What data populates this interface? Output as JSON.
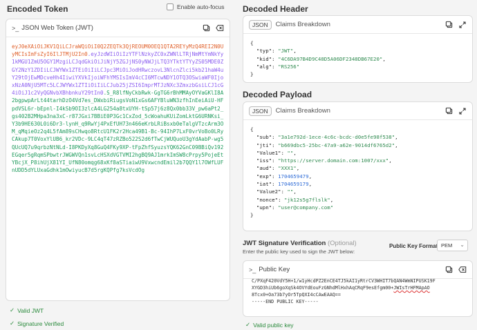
{
  "left": {
    "encoded_title": "Encoded Token",
    "autofocus_label": "Enable auto-focus",
    "card_title": "JSON Web Token (JWT)",
    "jwt_header": "eyJ0eXAiOiJKV1QiLCJraWQiOiI0Q2ZEQTk3QjREOUM0OEQ1QTA2REYyMzQ4REI2N0UyMCIsImFsZyI6IlJTMjU2In0",
    "jwt_payload": ".eyJzdWIiOiIzYTFlNzkyZC0xZWNlLTRjNmMtYmNkYy1kMGU1ZmU5OGY1MzgiLCJqdGkiOiJiNjY5ZGJjNS0yNWJjLTQ3YTktYTYyZS05MDE0ZGY2NzY1ZDIiLCJWYWx1ZTEiOiIiLCJpc3MiOiJodHRwczovL3NlcnZlci5kb21haW4uY29tOjEwMDcveHh4IiwiYXVkIjoiWFhYMSIsImV4cCI6MTcwNDY1OTQ3OSwiaWF0IjoxNzA0NjU5MTc5LCJWYWx1ZTIiOiIiLCJub25jZSI6ImprMTJzNXc3ZmxzbGsiLCJ1cG4iOiJ1c2VyQGNvbXBhbnkuY29tIn0",
    "jwt_signature": ".S_R8lfNyCkbRwk-GgTG6rBhMMAyOYVaGKlI8A2bgpwpArLt44tarhDzO4Vd7es_DWxbiRiugsVoN1xGs6AFYBluWN3zfhInEeiAiU-HFpdVSL6r-bEpnl-I4kSb9OI3zlcA4LG254a8txUYH-tSp57j6z8Qx0bb33V_pw6aPt2_gs402B2MHpa3na3xC-r87JGxi7BBiE0P3Gc1CxZod_5cWoahuKUiZomLktG6URNKsi_Y3b9HE630L0i6Dr3-lynH_q9RwYj4PxEfUH73n466eKrbLRiBsxb0eTalgVTzcArm3OM_qMqieOz2q4L5fAm89sCHwqo8RtcU1FK2r2Hca49B1-Bc-94IhP7LxF0vrVoBo0LRyCAkup7T0VoxYlUB6_kr2VDc-9LC4qT47zRZBo522S2d6fTwCjWUQuoU3gYdAabP-wg5QUcUQ7u9qrbzNtNLd-I8PKDyXq8GuQ4FKy9XP-tFpZhfSyuzsYQK62GnC09BBiQv192EGqer5gRqmSPbwtrJWGWVQn1svLcHSXdVGTVMI2hgBQ9AJ1mrkImSW8cPrpy5PojeEtYBcjX_P8ihUjX81YI_UfN80omqg68xKf8aSTiaiwU9VxwcndEmil2b7QQY1l7OWfLUFnUDD5dYLUxaGdhk1mOwiyucB7d5rgKQPfg7ksVcdOg",
    "valid_jwt": "Valid JWT",
    "signature_verified": "Signature Verified"
  },
  "right": {
    "header_title": "Decoded Header",
    "payload_title": "Decoded Payload",
    "tab_json": "JSON",
    "tab_claims": "Claims Breakdown",
    "header_json": {
      "typ": "\"JWT\"",
      "kid": "\"4C6DA97B4D9C48D5A06DF2348DB67E20\"",
      "alg": "\"RS256\""
    },
    "payload_json": {
      "sub": "\"3a1e792d-1ece-4c6c-bcdc-d0e5fe98f538\"",
      "jti": "\"b669dbc5-25bc-47a9-a62e-9014df6765d2\"",
      "Value1": "\"\"",
      "iss": "\"https://server.domain.com:1007/xxx\"",
      "aud": "\"XXX1\"",
      "exp": "1704659479",
      "iat": "1704659179",
      "Value2": "\"\"",
      "nonce": "\"jk12s5g7flslk\"",
      "upn": "\"user@company.com\""
    },
    "verify_title": "JWT Signature Verification",
    "verify_optional": "(Optional)",
    "verify_sub": "Enter the public key used to sign the JWT below:",
    "public_key_format_label": "Public Key Format",
    "public_key_format_value": "PEM",
    "public_key_card_title": "Public Key",
    "pk_line1": "C/PXqF420VdY5H+1/w1yHcdPZ2EnCE4TJ5kAI1yRtrCV3WHIT7bQAN4WmNIPUSK19F",
    "pk_line2a": "XYGD3hiUb6goXqSk4OVYdEouFzGNhdMlHxhAqCRqF9esEfgm00+",
    "pk_line2b": "JWIsTrHFMApAO",
    "pk_line3": "8Tcx0+Oa73b7yOr5TpQXI4cCAwEAAQ==",
    "pk_line4": "-----END PUBLIC KEY-----",
    "valid_public_key": "Valid public key"
  },
  "colors": {
    "header": "#e0602a",
    "payload": "#8a5cf0",
    "signature": "#1d9a5b",
    "valid": "#2a8a3c"
  }
}
